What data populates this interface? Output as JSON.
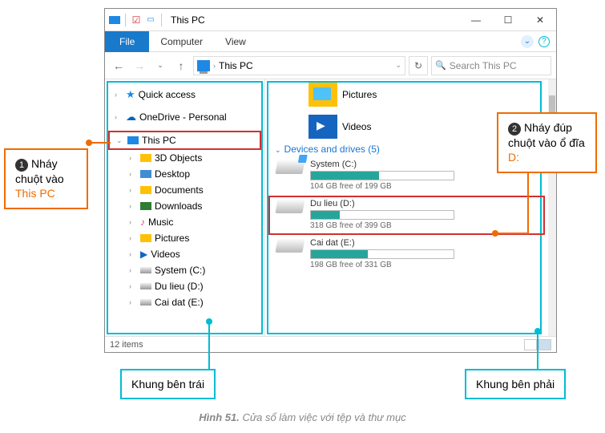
{
  "titlebar": {
    "title": "This PC"
  },
  "ribbon": {
    "file": "File",
    "computer": "Computer",
    "view": "View"
  },
  "nav": {
    "address": "This PC",
    "search": "Search This PC"
  },
  "tree": {
    "quick_access": "Quick access",
    "onedrive": "OneDrive - Personal",
    "this_pc": "This PC",
    "children": {
      "objects3d": "3D Objects",
      "desktop": "Desktop",
      "documents": "Documents",
      "downloads": "Downloads",
      "music": "Music",
      "pictures": "Pictures",
      "videos": "Videos",
      "system": "System (C:)",
      "dulieu": "Du lieu (D:)",
      "caidat": "Cai dat (E:)"
    }
  },
  "folders": {
    "pictures": "Pictures",
    "videos": "Videos"
  },
  "section": {
    "header": "Devices and drives (5)"
  },
  "drives": {
    "c": {
      "name": "System (C:)",
      "free": "104 GB free of 199 GB",
      "pct": 48
    },
    "d": {
      "name": "Du lieu (D:)",
      "free": "318 GB free of 399 GB",
      "pct": 20
    },
    "e": {
      "name": "Cai dat (E:)",
      "free": "198 GB free of 331 GB",
      "pct": 40
    }
  },
  "status": {
    "items": "12 items"
  },
  "callouts": {
    "c1_pre": "Nháy chuột vào",
    "c1_hl": "This PC",
    "c2_pre": "Nháy đúp chuột vào ổ đĩa",
    "c2_hl": "D:",
    "left": "Khung bên trái",
    "right": "Khung bên phải"
  },
  "caption": {
    "label": "Hình 51.",
    "text": "Cửa sổ làm việc với tệp và thư mục"
  }
}
